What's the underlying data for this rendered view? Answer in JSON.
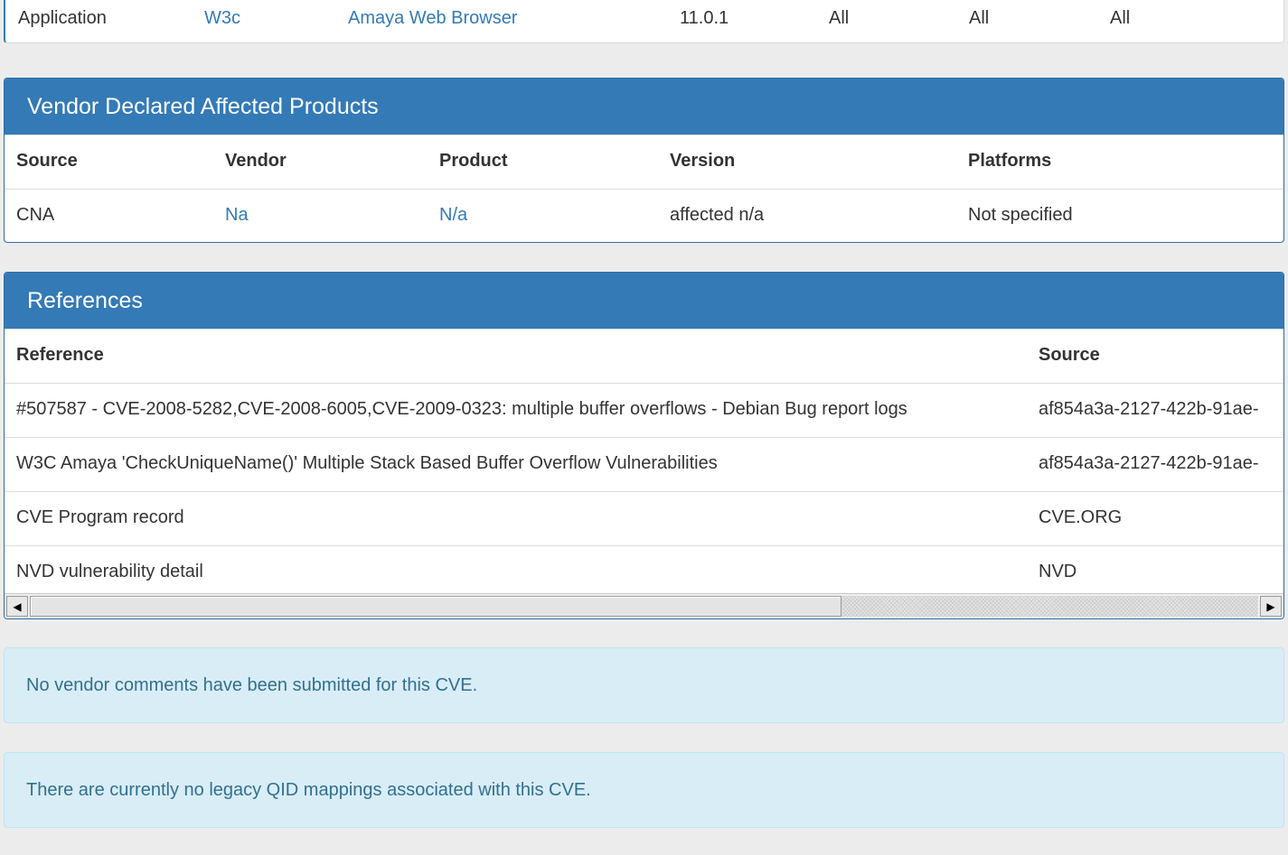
{
  "top_row": {
    "type": "Application",
    "vendor": "W3c",
    "product": "Amaya Web Browser",
    "version": "11.0.1",
    "update": "All",
    "edition": "All",
    "language": "All"
  },
  "vendor_declared": {
    "title": "Vendor Declared Affected Products",
    "headers": [
      "Source",
      "Vendor",
      "Product",
      "Version",
      "Platforms"
    ],
    "rows": [
      {
        "source": "CNA",
        "vendor": "Na",
        "product": "N/a",
        "version": "affected n/a",
        "platforms": "Not specified"
      }
    ]
  },
  "references": {
    "title": "References",
    "headers": [
      "Reference",
      "Source"
    ],
    "rows": [
      {
        "reference": "#507587 - CVE-2008-5282,CVE-2008-6005,CVE-2009-0323: multiple buffer overflows - Debian Bug report logs",
        "source": "af854a3a-2127-422b-91ae-"
      },
      {
        "reference": "W3C Amaya 'CheckUniqueName()' Multiple Stack Based Buffer Overflow Vulnerabilities",
        "source": "af854a3a-2127-422b-91ae-"
      },
      {
        "reference": "CVE Program record",
        "source": "CVE.ORG"
      },
      {
        "reference": "NVD vulnerability detail",
        "source": "NVD"
      }
    ],
    "scrollbar": {
      "left_arrow": "◀",
      "right_arrow": "▶",
      "visible_fraction": 0.65
    }
  },
  "alerts": {
    "vendor_comments": "No vendor comments have been submitted for this CVE.",
    "qid_mappings": "There are currently no legacy QID mappings associated with this CVE."
  },
  "colors": {
    "primary": "#337ab7",
    "link": "#337ab7",
    "alert_bg": "#d9edf7",
    "alert_text": "#31708f",
    "page_bg": "#ececec"
  }
}
